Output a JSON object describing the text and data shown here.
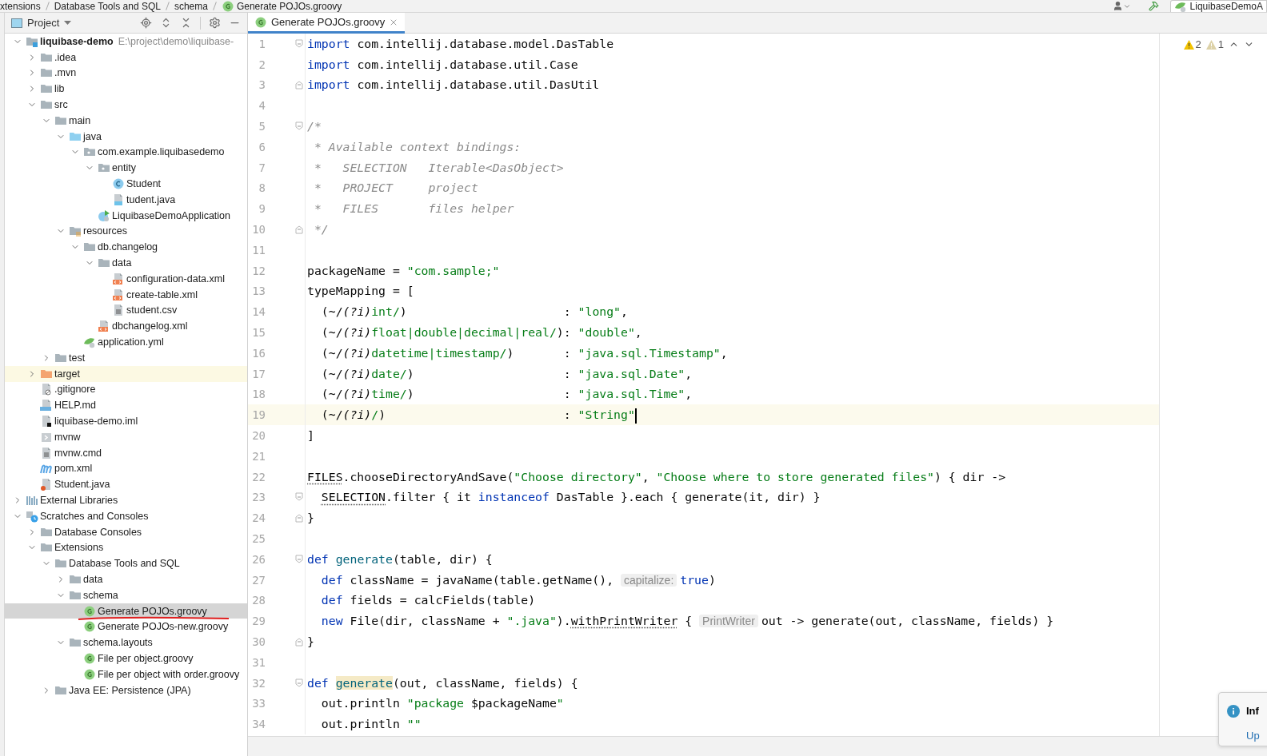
{
  "breadcrumbs": [
    {
      "label": "xtensions"
    },
    {
      "label": "Database Tools and SQL"
    },
    {
      "label": "schema"
    },
    {
      "label": "Generate POJOs.groovy",
      "kind": "groovy"
    }
  ],
  "run_config": {
    "label": "LiquibaseDemoA"
  },
  "project_panel": {
    "title": "Project",
    "tree": [
      {
        "label": "liquibase-demo",
        "kind": "module",
        "path": "E:\\project\\demo\\liquibase-",
        "expanded": true,
        "selected": false,
        "children": [
          {
            "label": ".idea",
            "kind": "folder",
            "expanded": false,
            "selected": false
          },
          {
            "label": ".mvn",
            "kind": "folder",
            "expanded": false,
            "selected": false
          },
          {
            "label": "lib",
            "kind": "folder",
            "expanded": false,
            "selected": false
          },
          {
            "label": "src",
            "kind": "folder",
            "expanded": true,
            "selected": false,
            "children": [
              {
                "label": "main",
                "kind": "folder",
                "expanded": true,
                "selected": false,
                "children": [
                  {
                    "label": "java",
                    "kind": "source-folder",
                    "expanded": true,
                    "selected": false,
                    "children": [
                      {
                        "label": "com.example.liquibasedemo",
                        "kind": "package",
                        "expanded": true,
                        "selected": false,
                        "children": [
                          {
                            "label": "entity",
                            "kind": "package",
                            "expanded": true,
                            "selected": false,
                            "children": [
                              {
                                "label": "Student",
                                "kind": "class",
                                "selected": false
                              },
                              {
                                "label": "tudent.java",
                                "kind": "java-file",
                                "selected": false
                              }
                            ]
                          },
                          {
                            "label": "LiquibaseDemoApplication",
                            "kind": "spring-class",
                            "selected": false
                          }
                        ]
                      }
                    ]
                  },
                  {
                    "label": "resources",
                    "kind": "resources-folder",
                    "expanded": true,
                    "selected": false,
                    "children": [
                      {
                        "label": "db.changelog",
                        "kind": "folder",
                        "expanded": true,
                        "selected": false,
                        "children": [
                          {
                            "label": "data",
                            "kind": "folder",
                            "expanded": true,
                            "selected": false,
                            "children": [
                              {
                                "label": "configuration-data.xml",
                                "kind": "xml",
                                "selected": false
                              },
                              {
                                "label": "create-table.xml",
                                "kind": "xml",
                                "selected": false
                              },
                              {
                                "label": "student.csv",
                                "kind": "text",
                                "selected": false
                              }
                            ]
                          },
                          {
                            "label": "dbchangelog.xml",
                            "kind": "xml",
                            "selected": false
                          }
                        ]
                      },
                      {
                        "label": "application.yml",
                        "kind": "yml",
                        "selected": false
                      }
                    ]
                  }
                ]
              },
              {
                "label": "test",
                "kind": "folder",
                "expanded": false,
                "selected": false
              }
            ]
          },
          {
            "label": "target",
            "kind": "excluded-folder",
            "expanded": false,
            "selected": false
          },
          {
            "label": ".gitignore",
            "kind": "ignore-file",
            "selected": false
          },
          {
            "label": "HELP.md",
            "kind": "markdown",
            "selected": false
          },
          {
            "label": "liquibase-demo.iml",
            "kind": "iml",
            "selected": false
          },
          {
            "label": "mvnw",
            "kind": "shell",
            "selected": false
          },
          {
            "label": "mvnw.cmd",
            "kind": "text",
            "selected": false
          },
          {
            "label": "pom.xml",
            "kind": "maven",
            "selected": false
          },
          {
            "label": "Student.java",
            "kind": "java-error",
            "selected": false
          }
        ]
      },
      {
        "label": "External Libraries",
        "kind": "libraries",
        "expanded": false,
        "selected": false
      },
      {
        "label": "Scratches and Consoles",
        "kind": "scratches",
        "expanded": true,
        "selected": false,
        "children": [
          {
            "label": "Database Consoles",
            "kind": "folder",
            "expanded": false,
            "selected": false
          },
          {
            "label": "Extensions",
            "kind": "folder",
            "expanded": true,
            "selected": false,
            "children": [
              {
                "label": "Database Tools and SQL",
                "kind": "folder",
                "expanded": true,
                "selected": false,
                "children": [
                  {
                    "label": "data",
                    "kind": "folder",
                    "expanded": false,
                    "selected": false
                  },
                  {
                    "label": "schema",
                    "kind": "folder",
                    "expanded": true,
                    "selected": false,
                    "children": [
                      {
                        "label": "Generate POJOs.groovy",
                        "kind": "groovy",
                        "selected": true,
                        "marked": true
                      },
                      {
                        "label": "Generate POJOs-new.groovy",
                        "kind": "groovy",
                        "selected": false
                      }
                    ]
                  },
                  {
                    "label": "schema.layouts",
                    "kind": "folder",
                    "expanded": true,
                    "selected": false,
                    "children": [
                      {
                        "label": "File per object.groovy",
                        "kind": "groovy",
                        "selected": false
                      },
                      {
                        "label": "File per object with order.groovy",
                        "kind": "groovy",
                        "selected": false
                      }
                    ]
                  }
                ]
              },
              {
                "label": "Java EE: Persistence (JPA)",
                "kind": "folder",
                "expanded": false,
                "selected": false
              }
            ]
          }
        ]
      }
    ]
  },
  "editor": {
    "tabs": [
      {
        "label": "Generate POJOs.groovy",
        "kind": "groovy",
        "selected": true
      }
    ],
    "inspections": {
      "warnings": "2",
      "weak_warnings": "1"
    },
    "lines": [
      {
        "number": "1",
        "kind": "fold-start",
        "current": false,
        "tokens": [
          {
            "kind": "kw",
            "text": "import"
          },
          {
            "kind": "plain",
            "text": " com.intellij.database.model.DasTable"
          }
        ]
      },
      {
        "number": "2",
        "current": false,
        "tokens": [
          {
            "kind": "kw",
            "text": "import"
          },
          {
            "kind": "plain",
            "text": " com.intellij.database.util.Case"
          }
        ]
      },
      {
        "number": "3",
        "kind": "fold-end",
        "current": false,
        "tokens": [
          {
            "kind": "kw",
            "text": "import"
          },
          {
            "kind": "plain",
            "text": " com.intellij.database.util.DasUtil"
          }
        ]
      },
      {
        "number": "4",
        "current": false
      },
      {
        "number": "5",
        "kind": "fold-start",
        "current": false,
        "tokens": [
          {
            "kind": "comment",
            "text": "/*"
          }
        ]
      },
      {
        "number": "6",
        "current": false,
        "tokens": [
          {
            "kind": "comment",
            "text": " * Available context bindings:"
          }
        ]
      },
      {
        "number": "7",
        "current": false,
        "tokens": [
          {
            "kind": "comment",
            "text": " *   SELECTION   Iterable<DasObject>"
          }
        ]
      },
      {
        "number": "8",
        "current": false,
        "tokens": [
          {
            "kind": "comment",
            "text": " *   PROJECT     project"
          }
        ]
      },
      {
        "number": "9",
        "current": false,
        "tokens": [
          {
            "kind": "comment",
            "text": " *   FILES       files helper"
          }
        ]
      },
      {
        "number": "10",
        "kind": "fold-end",
        "current": false,
        "tokens": [
          {
            "kind": "comment",
            "text": " */"
          }
        ]
      },
      {
        "number": "11",
        "current": false
      },
      {
        "number": "12",
        "current": false,
        "tokens": [
          {
            "kind": "plain",
            "text": "packageName = "
          },
          {
            "kind": "str",
            "text": "\"com.sample;\""
          }
        ]
      },
      {
        "number": "13",
        "current": false,
        "tokens": [
          {
            "kind": "plain",
            "text": "typeMapping = ["
          }
        ]
      },
      {
        "number": "14",
        "current": false,
        "tokens": [
          {
            "kind": "plain",
            "text": "  (~/"
          },
          {
            "kind": "flag",
            "text": "(?i)"
          },
          {
            "kind": "str",
            "text": "int/"
          },
          {
            "kind": "plain",
            "text": ")                      : "
          },
          {
            "kind": "str",
            "text": "\"long\""
          },
          {
            "kind": "plain",
            "text": ","
          }
        ]
      },
      {
        "number": "15",
        "current": false,
        "tokens": [
          {
            "kind": "plain",
            "text": "  (~/"
          },
          {
            "kind": "flag",
            "text": "(?i)"
          },
          {
            "kind": "str",
            "text": "float|double|decimal|real/"
          },
          {
            "kind": "plain",
            "text": "): "
          },
          {
            "kind": "str",
            "text": "\"double\""
          },
          {
            "kind": "plain",
            "text": ","
          }
        ]
      },
      {
        "number": "16",
        "current": false,
        "tokens": [
          {
            "kind": "plain",
            "text": "  (~/"
          },
          {
            "kind": "flag",
            "text": "(?i)"
          },
          {
            "kind": "str",
            "text": "datetime|timestamp/"
          },
          {
            "kind": "plain",
            "text": ")       : "
          },
          {
            "kind": "str",
            "text": "\"java.sql.Timestamp\""
          },
          {
            "kind": "plain",
            "text": ","
          }
        ]
      },
      {
        "number": "17",
        "current": false,
        "tokens": [
          {
            "kind": "plain",
            "text": "  (~/"
          },
          {
            "kind": "flag",
            "text": "(?i)"
          },
          {
            "kind": "str",
            "text": "date/"
          },
          {
            "kind": "plain",
            "text": ")                     : "
          },
          {
            "kind": "str",
            "text": "\"java.sql.Date\""
          },
          {
            "kind": "plain",
            "text": ","
          }
        ]
      },
      {
        "number": "18",
        "current": false,
        "tokens": [
          {
            "kind": "plain",
            "text": "  (~/"
          },
          {
            "kind": "flag",
            "text": "(?i)"
          },
          {
            "kind": "str",
            "text": "time/"
          },
          {
            "kind": "plain",
            "text": ")                     : "
          },
          {
            "kind": "str",
            "text": "\"java.sql.Time\""
          },
          {
            "kind": "plain",
            "text": ","
          }
        ]
      },
      {
        "number": "19",
        "current": true,
        "tokens": [
          {
            "kind": "plain",
            "text": "  (~/"
          },
          {
            "kind": "flag",
            "text": "(?i)"
          },
          {
            "kind": "str",
            "text": "/"
          },
          {
            "kind": "plain",
            "text": ")                         : "
          },
          {
            "kind": "str",
            "text": "\"String\""
          }
        ]
      },
      {
        "number": "20",
        "current": false,
        "tokens": [
          {
            "kind": "plain",
            "text": "]"
          }
        ]
      },
      {
        "number": "21",
        "current": false
      },
      {
        "number": "22",
        "current": false,
        "tokens": [
          {
            "kind": "static",
            "text": "FILES"
          },
          {
            "kind": "plain",
            "text": ".chooseDirectoryAndSave("
          },
          {
            "kind": "str",
            "text": "\"Choose directory\""
          },
          {
            "kind": "plain",
            "text": ", "
          },
          {
            "kind": "str",
            "text": "\"Choose where to store generated files\""
          },
          {
            "kind": "plain",
            "text": ") { dir ->"
          }
        ]
      },
      {
        "number": "23",
        "kind": "fold-start",
        "current": false,
        "tokens": [
          {
            "kind": "static",
            "text": "  SELECTION"
          },
          {
            "kind": "plain",
            "text": ".filter { it "
          },
          {
            "kind": "kw",
            "text": "instanceof"
          },
          {
            "kind": "plain",
            "text": " DasTable }.each { generate(it, dir) }"
          }
        ]
      },
      {
        "number": "24",
        "kind": "fold-end",
        "current": false,
        "tokens": [
          {
            "kind": "plain",
            "text": "}"
          }
        ]
      },
      {
        "number": "25",
        "current": false
      },
      {
        "number": "26",
        "kind": "fold-start",
        "current": false,
        "tokens": [
          {
            "kind": "kw",
            "text": "def"
          },
          {
            "kind": "fn",
            "text": " generate"
          },
          {
            "kind": "plain",
            "text": "(table, dir) {"
          }
        ]
      },
      {
        "number": "27",
        "current": false,
        "tokens": [
          {
            "kind": "kw",
            "text": "  def"
          },
          {
            "kind": "plain",
            "text": " className = javaName(table.getName(), "
          },
          {
            "kind": "hint",
            "text": "capitalize:"
          },
          {
            "kind": "kw",
            "text": "true"
          },
          {
            "kind": "plain",
            "text": ")"
          }
        ]
      },
      {
        "number": "28",
        "current": false,
        "tokens": [
          {
            "kind": "kw",
            "text": "  def"
          },
          {
            "kind": "plain",
            "text": " fields = calcFields(table)"
          }
        ]
      },
      {
        "number": "29",
        "current": false,
        "tokens": [
          {
            "kind": "kw",
            "text": "  new"
          },
          {
            "kind": "plain",
            "text": " File(dir, className + "
          },
          {
            "kind": "str",
            "text": "\".java\""
          },
          {
            "kind": "plain",
            "text": ")."
          },
          {
            "kind": "static",
            "text": "withPrintWriter"
          },
          {
            "kind": "plain",
            "text": " { "
          },
          {
            "kind": "hint",
            "text": "PrintWriter"
          },
          {
            "kind": "plain",
            "text": "out -> generate(out, className, fields) }"
          }
        ]
      },
      {
        "number": "30",
        "kind": "fold-end",
        "current": false,
        "tokens": [
          {
            "kind": "plain",
            "text": "}"
          }
        ]
      },
      {
        "number": "31",
        "current": false
      },
      {
        "number": "32",
        "kind": "fold-start",
        "current": false,
        "tokens": [
          {
            "kind": "kw",
            "text": "def"
          },
          {
            "kind": "usage",
            "text": " generate"
          },
          {
            "kind": "plain",
            "text": "(out, className, fields) {"
          }
        ]
      },
      {
        "number": "33",
        "current": false,
        "tokens": [
          {
            "kind": "plain",
            "text": "  out.println "
          },
          {
            "kind": "str",
            "text": "\"package "
          },
          {
            "kind": "plain",
            "text": "$packageName"
          },
          {
            "kind": "str",
            "text": "\""
          }
        ]
      },
      {
        "number": "34",
        "current": false,
        "tokens": [
          {
            "kind": "plain",
            "text": "  out.println "
          },
          {
            "kind": "str",
            "text": "\"\""
          }
        ]
      }
    ]
  },
  "notification": {
    "title": "Inf",
    "link": "Up"
  }
}
